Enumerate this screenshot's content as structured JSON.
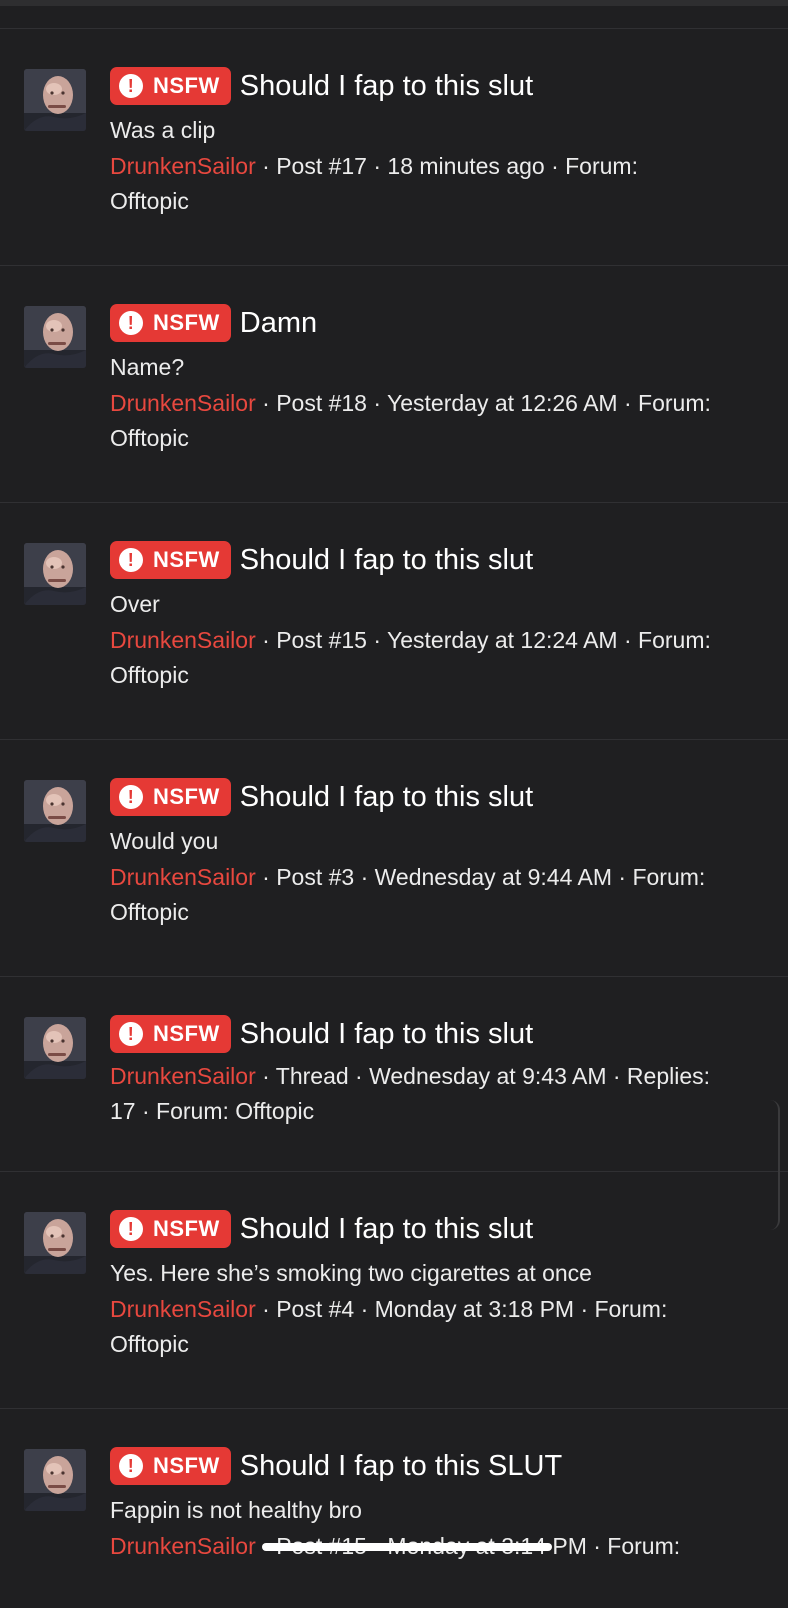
{
  "badge": "NSFW",
  "forum_label": "Forum:",
  "results": [
    {
      "title": "Should I fap to this slut",
      "snippet": "Was a clip",
      "author": "DrunkenSailor",
      "line1": " · Post #17 · 18 minutes ago · Forum:",
      "line2": "Offtopic"
    },
    {
      "title": "Damn",
      "snippet": "Name?",
      "author": "DrunkenSailor",
      "line1": " · Post #18 · Yesterday at 12:26 AM · Forum:",
      "line2": "Offtopic"
    },
    {
      "title": "Should I fap to this slut",
      "snippet": "Over",
      "author": "DrunkenSailor",
      "line1": " · Post #15 · Yesterday at 12:24 AM · Forum:",
      "line2": "Offtopic"
    },
    {
      "title": "Should I fap to this slut",
      "snippet": "Would you",
      "author": "DrunkenSailor",
      "line1": " · Post #3 · Wednesday at 9:44 AM · Forum:",
      "line2": "Offtopic"
    },
    {
      "title": "Should I fap to this slut",
      "snippet": "",
      "author": "DrunkenSailor",
      "line1": " · Thread · Wednesday at 9:43 AM · Replies:",
      "line2": "17 · Forum: Offtopic"
    },
    {
      "title": "Should I fap to this slut",
      "snippet": "Yes. Here she’s smoking two cigarettes at once",
      "author": "DrunkenSailor",
      "line1": " · Post #4 · Monday at 3:18 PM · Forum:",
      "line2": "Offtopic"
    },
    {
      "title": "Should I fap to this SLUT",
      "snippet": "Fappin is not healthy bro",
      "author": "DrunkenSailor",
      "line1": " · Post #15 · Monday at 3:14 PM · Forum:",
      "line2": ""
    }
  ]
}
